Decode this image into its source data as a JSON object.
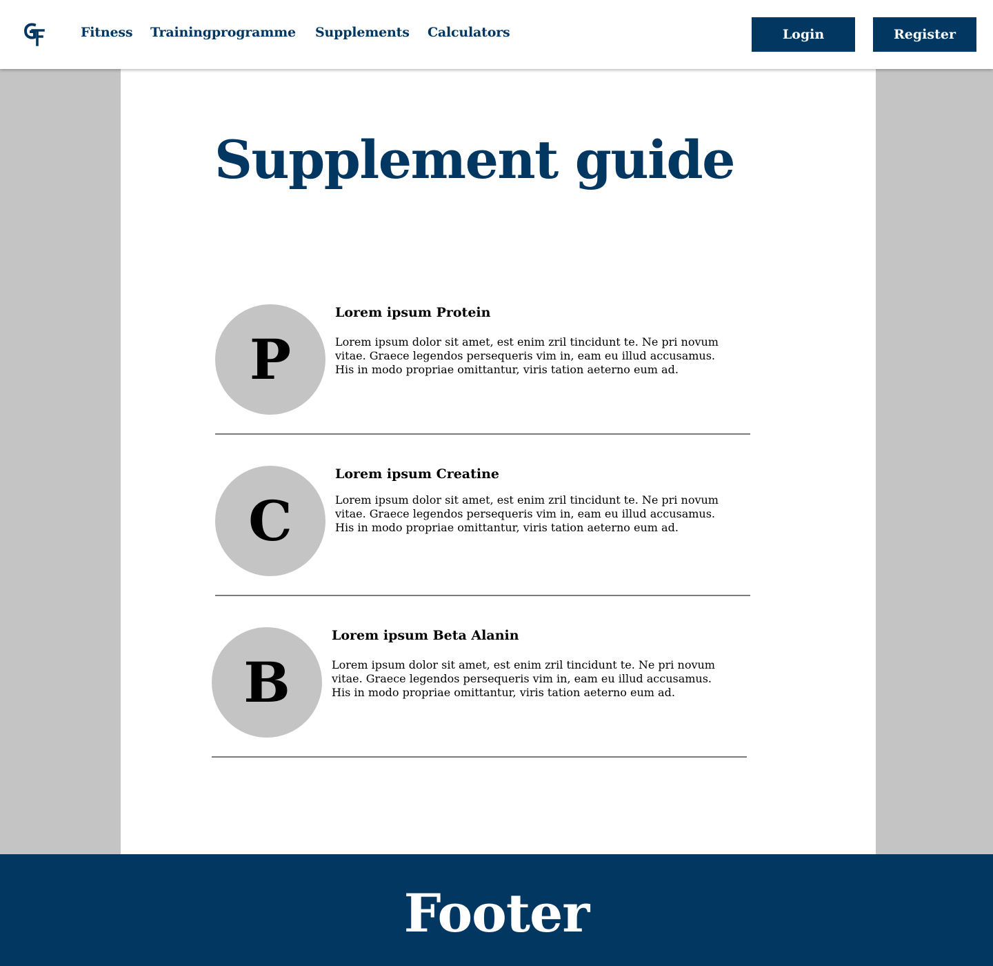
{
  "colors": {
    "brand": "#023761",
    "backdrop": "#c4c4c4",
    "panel": "#ffffff",
    "divider": "#7a7a7a"
  },
  "header": {
    "logo_icon": "gf-monogram-icon",
    "nav": [
      {
        "label": "Fitness"
      },
      {
        "label": "Trainingprogramme"
      },
      {
        "label": "Supplements"
      },
      {
        "label": "Calculators"
      }
    ],
    "login_label": "Login",
    "register_label": "Register"
  },
  "main": {
    "title": "Supplement guide",
    "items": [
      {
        "letter": "P",
        "title": "Lorem ipsum Protein",
        "text": "Lorem ipsum dolor sit amet, est enim zril tincidunt te. Ne pri novum vitae. Graece legendos persequeris vim in, eam eu illud accusamus. His in modo propriae omittantur, viris tation aeterno eum ad."
      },
      {
        "letter": "C",
        "title": "Lorem ipsum Creatine",
        "text": "Lorem ipsum dolor sit amet, est enim zril tincidunt te. Ne pri novum vitae. Graece legendos persequeris vim in, eam eu illud accusamus. His in modo propriae omittantur, viris tation aeterno eum ad."
      },
      {
        "letter": "B",
        "title": "Lorem ipsum Beta Alanin",
        "text": "Lorem ipsum dolor sit amet, est enim zril tincidunt te. Ne pri novum vitae. Graece legendos persequeris vim in, eam eu illud accusamus. His in modo propriae omittantur, viris tation aeterno eum ad."
      }
    ]
  },
  "footer": {
    "title": "Footer"
  }
}
